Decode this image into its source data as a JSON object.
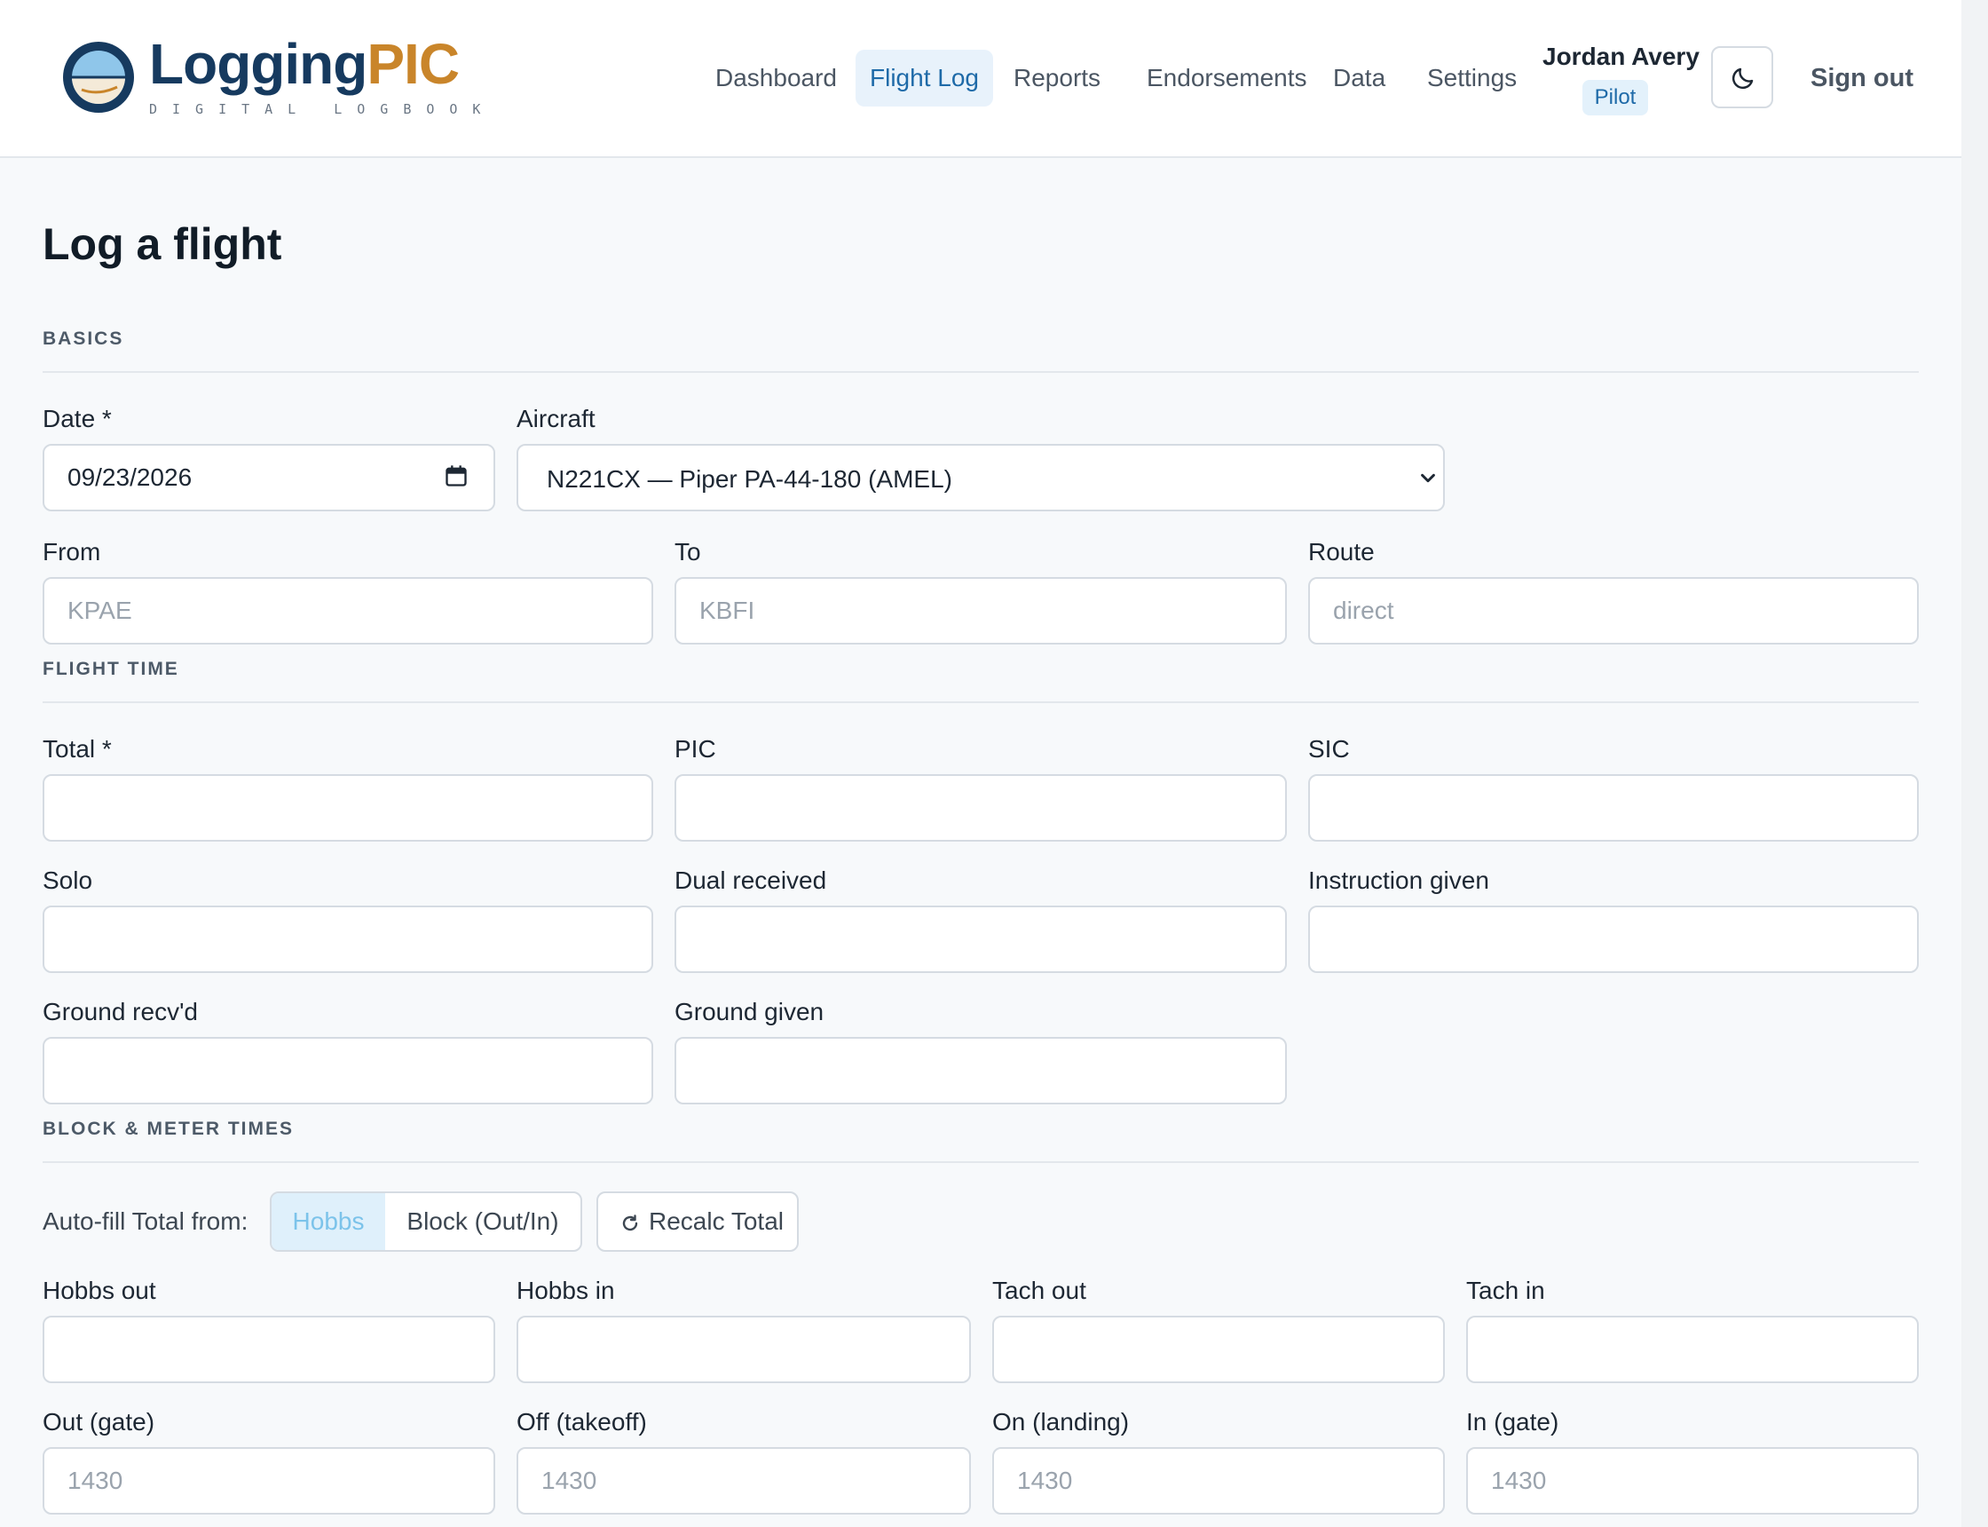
{
  "brand": {
    "name_part1": "Logging",
    "name_part2": "PIC",
    "tagline": "DIGITAL LOGBOOK"
  },
  "nav": {
    "items": [
      {
        "label": "Dashboard"
      },
      {
        "label": "Flight Log"
      },
      {
        "label": "Reports"
      },
      {
        "label": "Endorsements"
      },
      {
        "label": "Data"
      },
      {
        "label": "Settings"
      }
    ],
    "active": "Flight Log"
  },
  "user": {
    "name": "Jordan Avery",
    "role": "Pilot"
  },
  "header": {
    "theme_icon": "moon-icon",
    "signout_label": "Sign out"
  },
  "page": {
    "title": "Log a flight"
  },
  "sections": {
    "basics": "BASICS",
    "flight_time": "FLIGHT TIME",
    "block_meter": "BLOCK & METER TIMES"
  },
  "basics": {
    "date": {
      "label": "Date *",
      "value": "09/23/2026"
    },
    "aircraft": {
      "label": "Aircraft",
      "value": "N221CX — Piper PA-44-180 (AMEL)"
    },
    "from": {
      "label": "From",
      "placeholder": "KPAE"
    },
    "to": {
      "label": "To",
      "placeholder": "KBFI"
    },
    "route": {
      "label": "Route",
      "placeholder": "direct"
    }
  },
  "flight_time": {
    "total": "Total *",
    "pic": "PIC",
    "sic": "SIC",
    "solo": "Solo",
    "dual_received": "Dual received",
    "instruction_given": "Instruction given",
    "ground_recvd": "Ground recv'd",
    "ground_given": "Ground given"
  },
  "block": {
    "autofill_label": "Auto-fill Total from:",
    "options": [
      "Hobbs",
      "Block (Out/In)"
    ],
    "selected": "Hobbs",
    "recalc_label": "Recalc Total",
    "hobbs_out": "Hobbs out",
    "hobbs_in": "Hobbs in",
    "tach_out": "Tach out",
    "tach_in": "Tach in",
    "out_gate": {
      "label": "Out (gate)",
      "placeholder": "1430"
    },
    "off_takeoff": {
      "label": "Off (takeoff)",
      "placeholder": "1430"
    },
    "on_landing": {
      "label": "On (landing)",
      "placeholder": "1430"
    },
    "in_gate": {
      "label": "In (gate)",
      "placeholder": "1430"
    }
  },
  "colors": {
    "brand_navy": "#163a5f",
    "brand_gold": "#c9852a",
    "accent": "#1e6aa8",
    "active_bg": "#e8f2fb"
  }
}
